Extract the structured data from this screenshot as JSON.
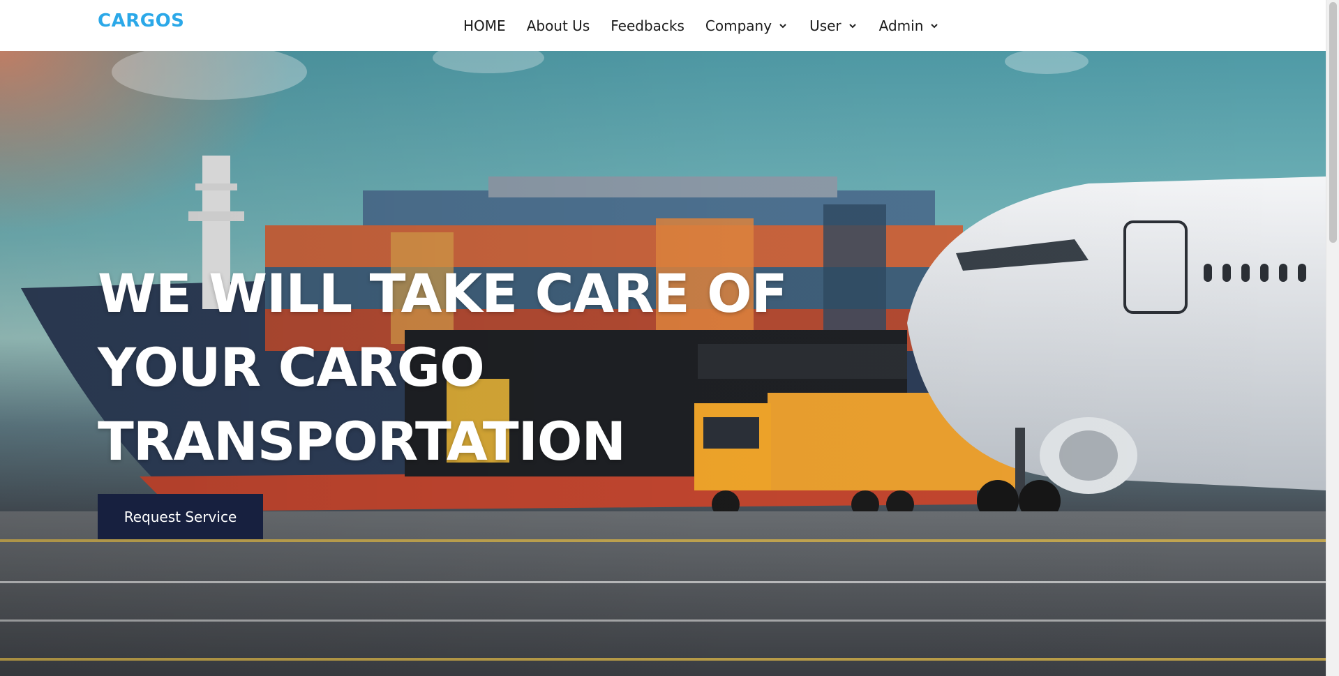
{
  "brand": {
    "logo": "CARGOS",
    "accent": "#2ba8e8"
  },
  "nav": {
    "items": [
      {
        "label": "HOME",
        "dropdown": false
      },
      {
        "label": "About Us",
        "dropdown": false
      },
      {
        "label": "Feedbacks",
        "dropdown": false
      },
      {
        "label": "Company",
        "dropdown": true
      },
      {
        "label": "User",
        "dropdown": true
      },
      {
        "label": "Admin",
        "dropdown": true
      }
    ]
  },
  "hero": {
    "title_lines": [
      "WE WILL TAKE CARE OF",
      "YOUR CARGO",
      "TRANSPORTATION"
    ],
    "cta_label": "Request Service",
    "cta_color": "#17203f"
  }
}
